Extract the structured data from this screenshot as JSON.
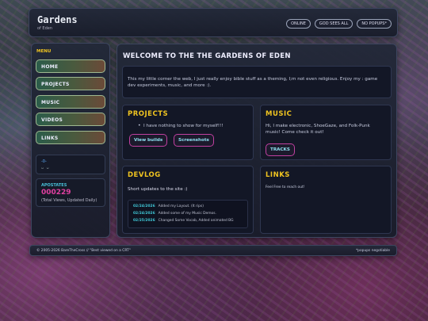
{
  "header": {
    "title": "Gardens",
    "subtitle": "of Eden",
    "badges": [
      "ONLINE",
      "GOD SEES ALL",
      "NO POPUPS*"
    ]
  },
  "sidebar": {
    "menu_label": "MENU",
    "items": [
      {
        "label": "HOME"
      },
      {
        "label": "PROJECTS"
      },
      {
        "label": "MUSIC"
      },
      {
        "label": "VIDEOS"
      },
      {
        "label": "LINKS"
      }
    ],
    "kaomoji_line1": "-0-",
    "kaomoji_line2": "ᴗ ᴗ",
    "apostates_label": "APOSTATES",
    "apostates_count": "000229",
    "apostates_note": "(Total Views, Updated Daily)"
  },
  "main": {
    "welcome_title": "WELCOME TO THE THE GARDENS OF EDEN",
    "intro": "This my little corner the web, I just really enjoy bible stuff as a theming, I;m not even religious. Enjoy my : game dev experiments, music, and more :).",
    "projects": {
      "title": "PROJECTS",
      "bullet": "I have nothing to show for myself!!!",
      "button1": "View builds",
      "button2": "Screenshots"
    },
    "music": {
      "title": "MUSIC",
      "text": "Hi, I make electronic, ShoeGaze, and Folk-Punk music! Come check it out!",
      "button": "TRACKS"
    },
    "devlog": {
      "title": "DEVLOG",
      "subtitle": "Short updates to the site :)",
      "entries": [
        {
          "date": "02/24/2026",
          "text": "Added my Layout. (It rips)"
        },
        {
          "date": "02/24/2026",
          "text": "Added some of my Music Demos."
        },
        {
          "date": "02/25/2026",
          "text": "Changed Some Vocab, Added animated BG"
        }
      ]
    },
    "links": {
      "title": "LINKS",
      "text": "Feel Free to reach out!"
    }
  },
  "footer": {
    "left": "© 2005-2026 BareTheCross // \"Best viewed on a CRT\"",
    "right": "*popups negotiable"
  },
  "colors": {
    "accent_yellow": "#f0c420",
    "accent_cyan": "#40c8d8",
    "accent_magenta": "#e040a0"
  }
}
